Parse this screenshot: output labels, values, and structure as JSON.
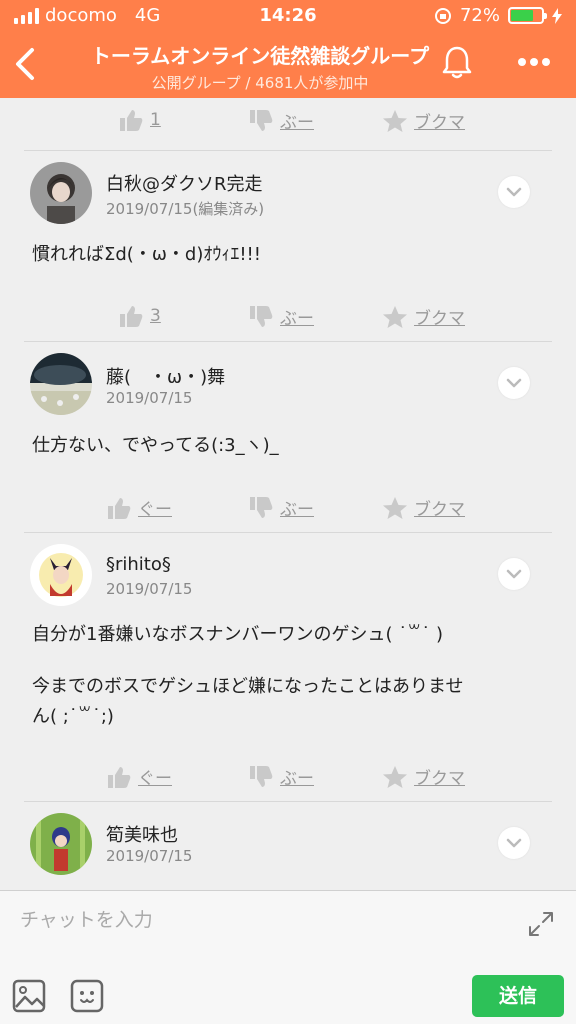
{
  "status": {
    "carrier": "docomo",
    "network": "4G",
    "time": "14:26",
    "battery": "72%",
    "battery_level": 0.72
  },
  "header": {
    "title": "トーラムオンライン徒然雑談グループ",
    "subtitle": "公開グループ / 4681人が参加中"
  },
  "top_actions": {
    "like": "1",
    "boo": "ぶー",
    "bookmark": "ブクマ"
  },
  "posts": [
    {
      "name": "白秋@ダクソR完走",
      "date": "2019/07/15(編集済み)",
      "text": "慣れればΣd(・ω・d)ｵｳｨｴ!!!",
      "actions": {
        "like": "3",
        "boo": "ぶー",
        "bookmark": "ブクマ"
      }
    },
    {
      "name": "藤(　・ω・)舞",
      "date": "2019/07/15",
      "text": "仕方ない、でやってる(:3_ヽ)_",
      "actions": {
        "like": "ぐー",
        "boo": "ぶー",
        "bookmark": "ブクマ"
      }
    },
    {
      "name": "§rihito§",
      "date": "2019/07/15",
      "text_line1": "自分が1番嫌いなボスナンバーワンのゲシュ( ˙꒳˙ )",
      "text_line2": "今までのボスでゲシュほど嫌になったことはありませ",
      "text_line3": "ん( ;˙꒳˙;)",
      "actions": {
        "like": "ぐー",
        "boo": "ぶー",
        "bookmark": "ブクマ"
      }
    },
    {
      "name": "筍美味也",
      "date": "2019/07/15"
    }
  ],
  "composer": {
    "placeholder": "チャットを入力",
    "send_label": "送信"
  },
  "colors": {
    "header": "#ff7f4a",
    "send": "#2dc158",
    "battery": "#3ad04a"
  }
}
